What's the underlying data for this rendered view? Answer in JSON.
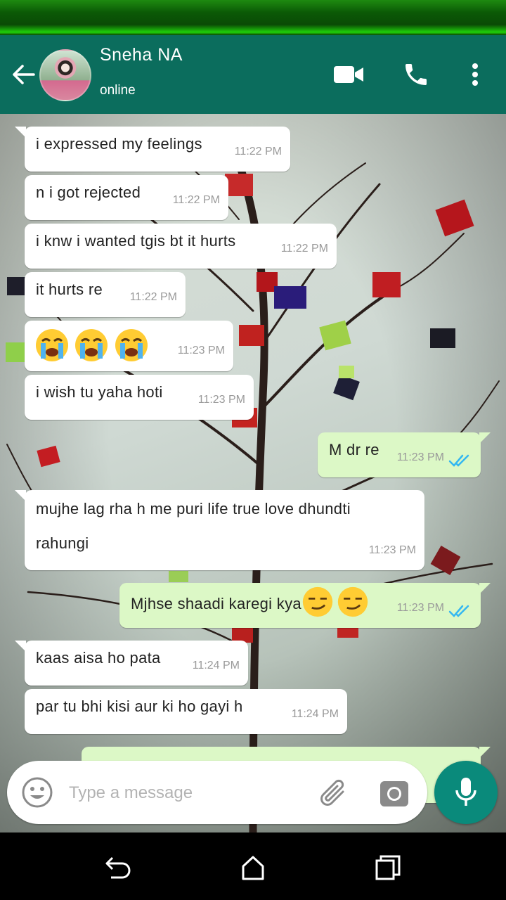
{
  "header": {
    "contact_name": "Sneha NA",
    "status": "online",
    "icons": [
      "back-arrow-icon",
      "video-call-icon",
      "phone-icon",
      "more-vert-icon"
    ]
  },
  "messages": [
    {
      "dir": "in",
      "text": "i expressed my feelings",
      "time": "11:22 PM"
    },
    {
      "dir": "in",
      "text": "n i got rejected",
      "time": "11:22 PM"
    },
    {
      "dir": "in",
      "text": "i knw i wanted tgis bt it hurts",
      "time": "11:22 PM"
    },
    {
      "dir": "in",
      "text": "it hurts re",
      "time": "11:22 PM"
    },
    {
      "dir": "in",
      "text": "",
      "emoji": [
        "loudly-crying-face",
        "loudly-crying-face",
        "loudly-crying-face"
      ],
      "time": "11:23 PM"
    },
    {
      "dir": "in",
      "text": "i wish tu yaha hoti",
      "time": "11:23 PM"
    },
    {
      "dir": "out",
      "text": "M dr re",
      "time": "11:23 PM",
      "status": "read"
    },
    {
      "dir": "in",
      "text_line1": "mujhe lag rha h me puri life true love dhundti",
      "text_line2": "rahungi",
      "time": "11:23 PM"
    },
    {
      "dir": "out",
      "text": "Mjhse shaadi karegi kya",
      "emoji": [
        "smirking-face",
        "smirking-face"
      ],
      "time": "11:23 PM",
      "status": "read"
    },
    {
      "dir": "in",
      "text": "kaas aisa ho pata",
      "time": "11:24 PM"
    },
    {
      "dir": "in",
      "text": "par tu bhi kisi aur ki ho gayi h",
      "time": "11:24 PM"
    }
  ],
  "composer": {
    "placeholder": "Type a message",
    "icons": [
      "emoji-icon",
      "attach-icon",
      "camera-icon",
      "mic-icon"
    ]
  },
  "colors": {
    "header": "#0b6d5d",
    "outgoing_bubble": "#dcf8c6",
    "incoming_bubble": "#ffffff",
    "read_ticks": "#34b7f1",
    "mic_button": "#0a8a7b"
  }
}
